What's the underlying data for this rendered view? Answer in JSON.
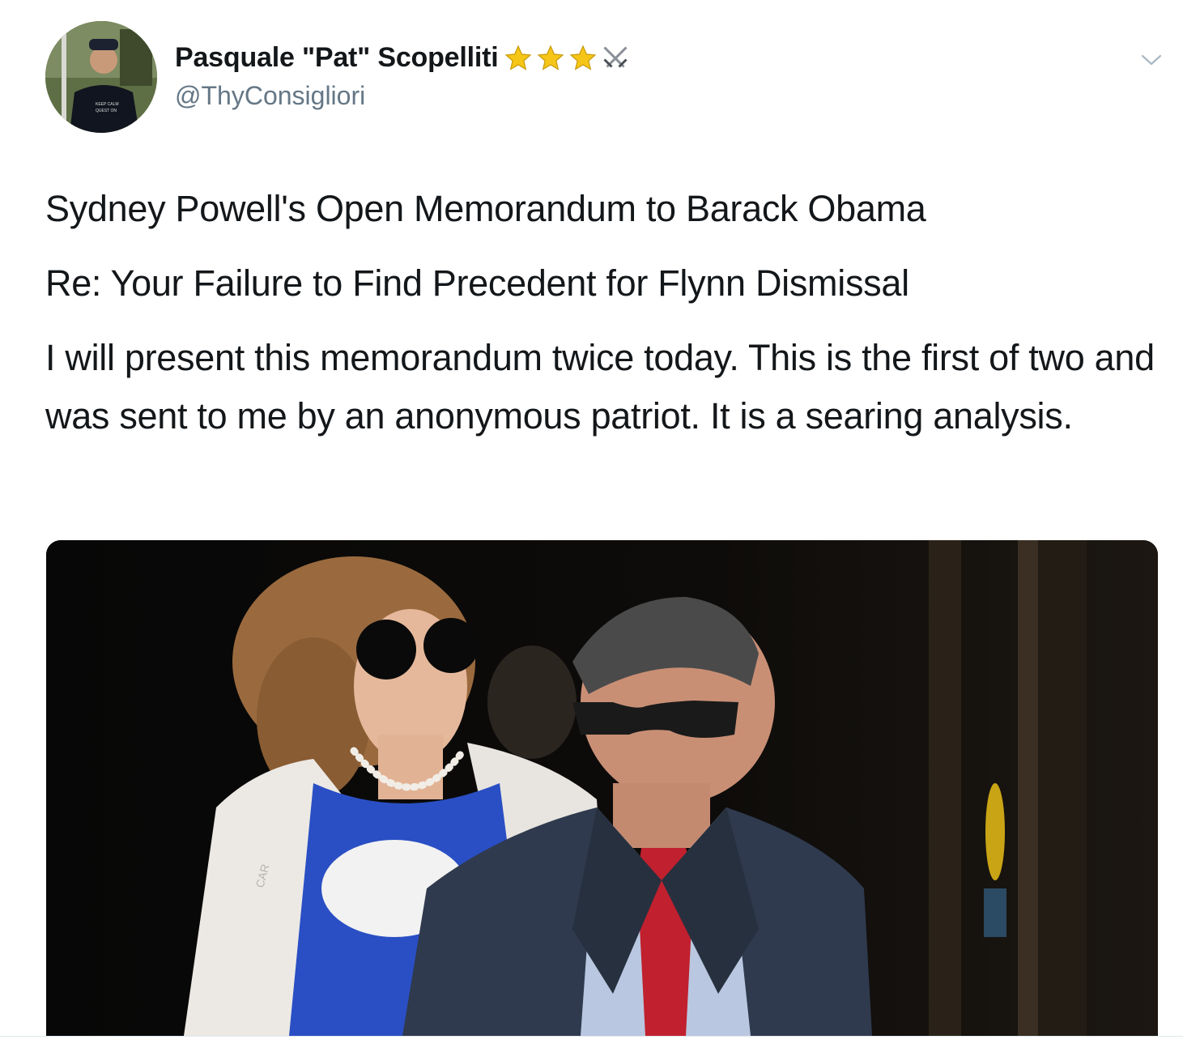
{
  "tweet": {
    "author": {
      "display_name": "Pasquale \"Pat\" Scopelliti",
      "handle": "@ThyConsigliori",
      "badges": [
        "star-icon",
        "star-icon",
        "star-icon",
        "crossed-swords-icon"
      ],
      "avatar_shirt_text": "KEEP CALM AND QUEST ON"
    },
    "menu_icon": "chevron-down-icon",
    "lines": {
      "title": "Sydney Powell's Open Memorandum to Barack Obama",
      "subject": "Re: Your Failure to Find Precedent for Flynn Dismissal",
      "body": "I will present this memorandum twice today. This is the first of two and was sent to me by an anonymous patriot. It is a searing analysis."
    },
    "media": {
      "sign_text": "CAR"
    }
  },
  "colors": {
    "text": "#14171a",
    "secondary_text": "#657786",
    "star": "#f5c518",
    "divider": "#e1e8ed"
  }
}
